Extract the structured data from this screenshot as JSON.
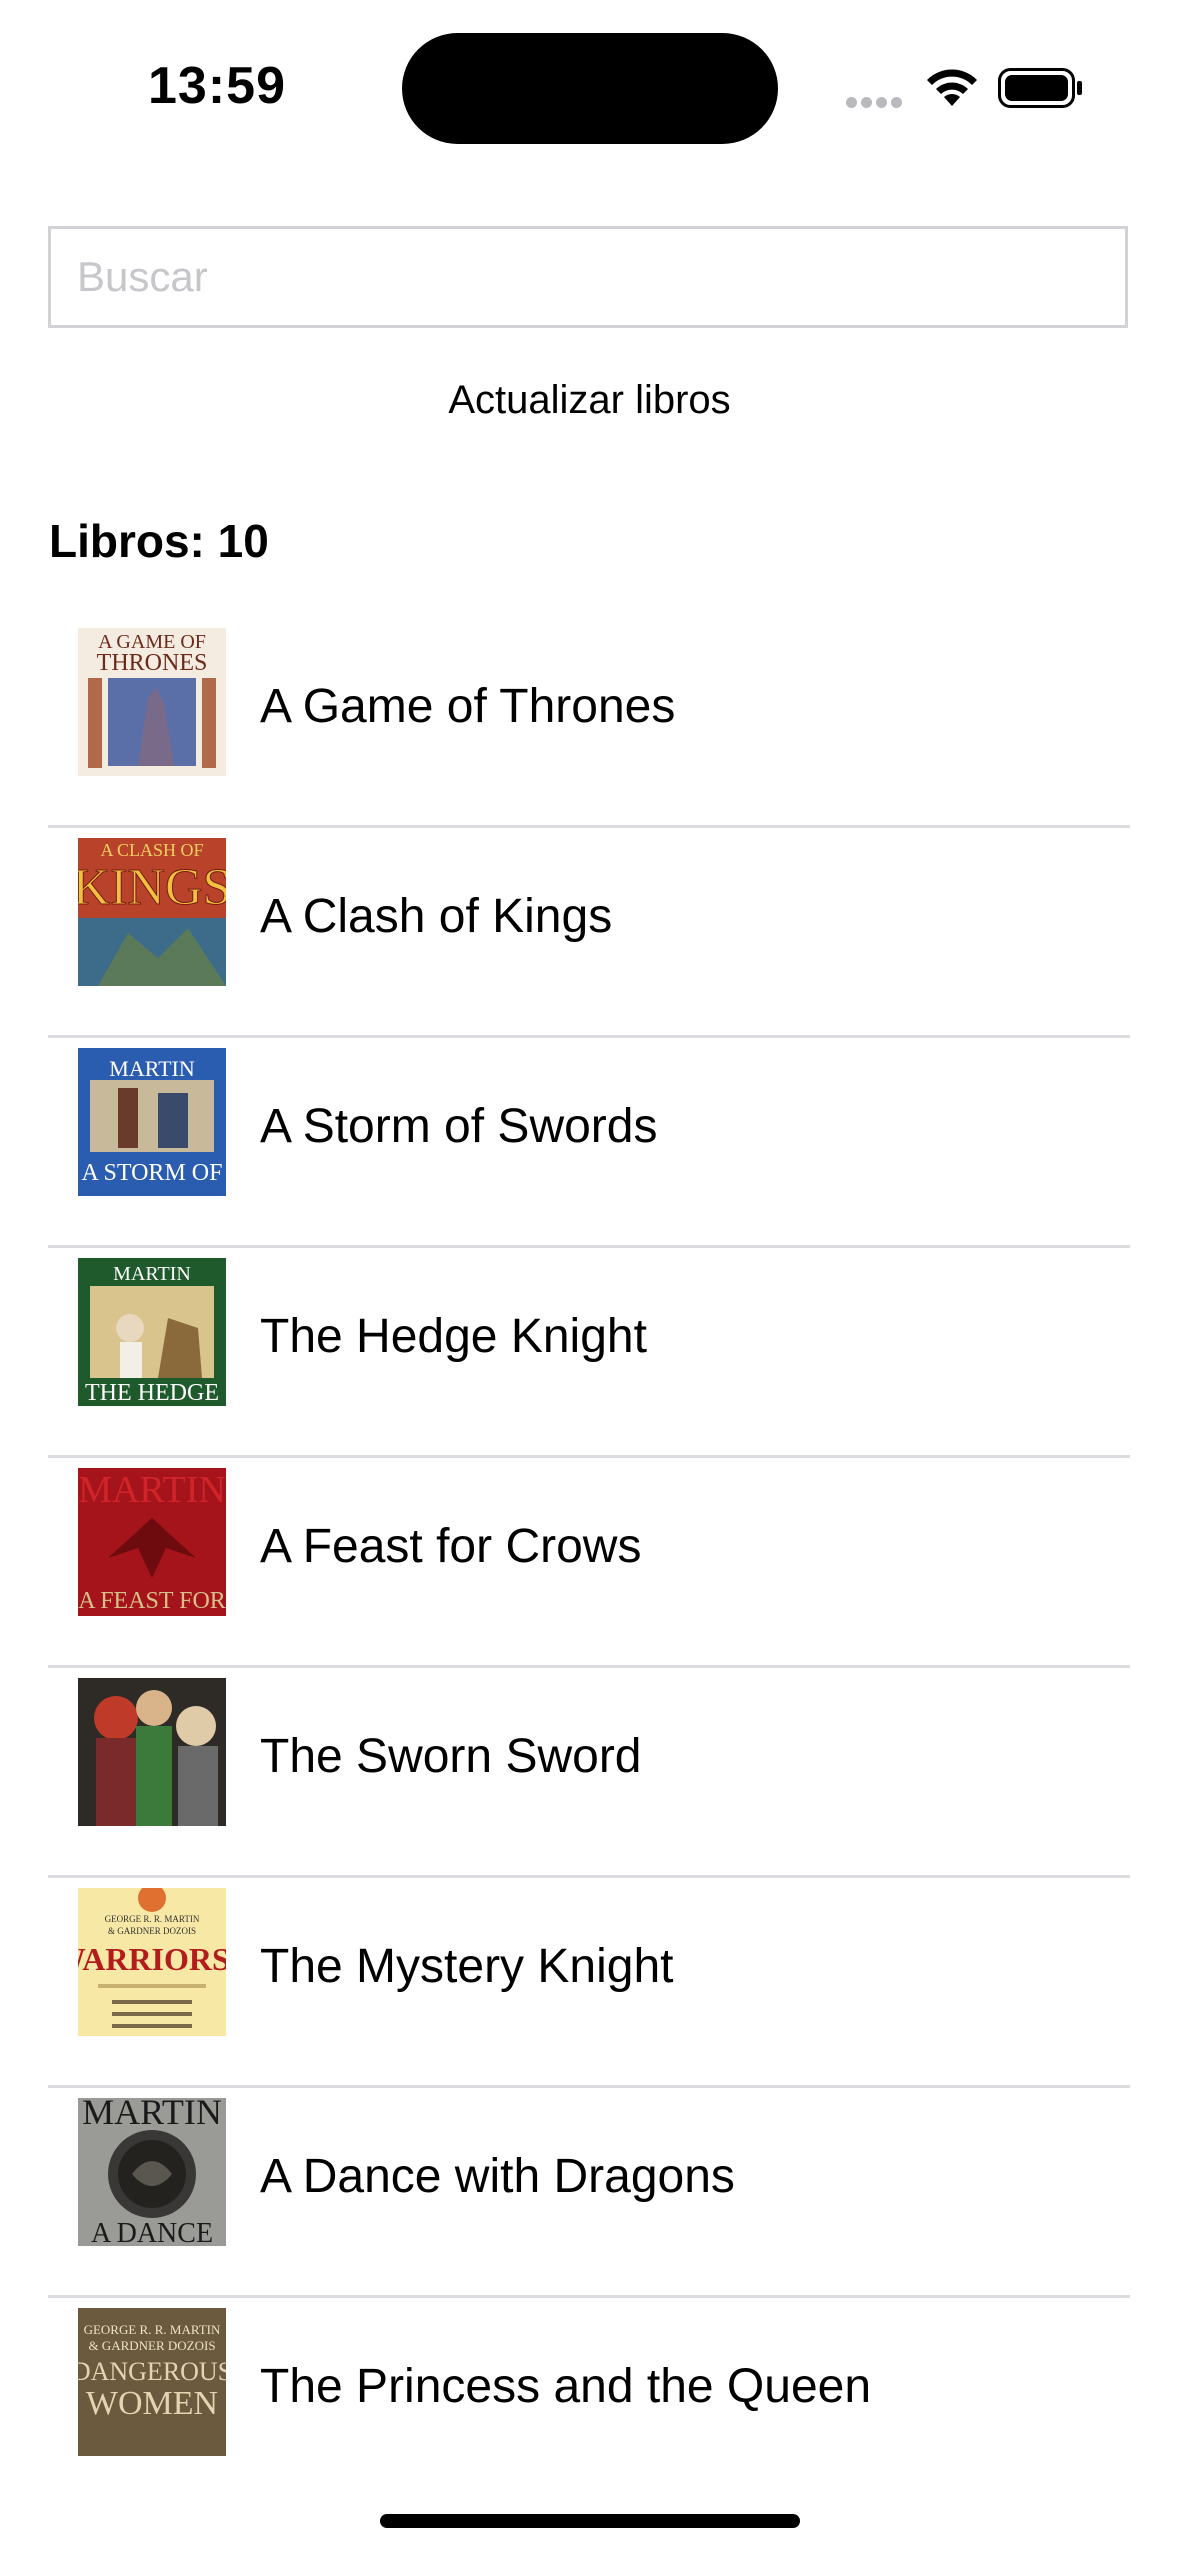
{
  "status_bar": {
    "time": "13:59"
  },
  "search": {
    "placeholder": "Buscar",
    "value": ""
  },
  "refresh_label": "Actualizar libros",
  "count_label": "Libros: 10",
  "books": [
    {
      "title": "A Game of Thrones",
      "cover_text_top": "A GAME OF THRONES",
      "cover_colors": [
        "#f4ece0",
        "#5a6fa8"
      ]
    },
    {
      "title": "A Clash of Kings",
      "cover_text_top": "A CLASH OF KINGS",
      "cover_colors": [
        "#b8432a",
        "#3d6b8a"
      ]
    },
    {
      "title": "A Storm of Swords",
      "cover_text_top": "MARTIN",
      "cover_text_bottom": "A STORM OF SWORDS",
      "cover_colors": [
        "#2a5db0",
        "#c7b99a"
      ]
    },
    {
      "title": "The Hedge Knight",
      "cover_text_top": "MARTIN",
      "cover_text_bottom": "THE HEDGE",
      "cover_colors": [
        "#1f5a2c",
        "#d9c48e"
      ]
    },
    {
      "title": "A Feast for Crows",
      "cover_text_top": "MARTIN",
      "cover_text_bottom": "A FEAST FOR",
      "cover_colors": [
        "#a5141a",
        "#6e0b0f"
      ]
    },
    {
      "title": "The Sworn Sword",
      "cover_colors": [
        "#3b7a3a",
        "#c9a27a"
      ]
    },
    {
      "title": "The Mystery Knight",
      "cover_text_top": "GEORGE R. R. MARTIN & GARDNER DOZOIS",
      "cover_text_bottom": "WARRIORS I",
      "cover_colors": [
        "#f7e8a6",
        "#b31c1c"
      ]
    },
    {
      "title": "A Dance with Dragons",
      "cover_text_top": "MARTIN",
      "cover_text_bottom": "A DANCE",
      "cover_colors": [
        "#9a9a96",
        "#3a3836"
      ]
    },
    {
      "title": "The Princess and the Queen",
      "cover_text_top": "GEORGE R. R. MARTIN & GARDNER DOZOIS",
      "cover_text_bottom": "DANGEROUS WOMEN",
      "cover_colors": [
        "#6b5a3e",
        "#e3d4b2"
      ]
    }
  ]
}
